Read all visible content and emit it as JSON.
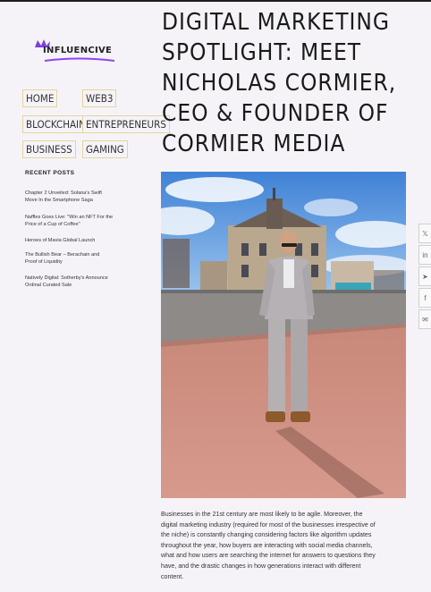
{
  "site": {
    "logo_text": "INFLUENCIVE"
  },
  "nav": {
    "home": "HOME",
    "web3": "WEB3",
    "blockchain": "BLOCKCHAIN",
    "entrepreneurs": "ENTREPRENEURS",
    "business": "BUSINESS",
    "gaming": "GAMING"
  },
  "recent_posts": {
    "title": "RECENT POSTS",
    "items": [
      {
        "l1": "Chapter 2 Unveiled: Solana's Swift",
        "l2": "Move In the Smartphone Saga"
      },
      {
        "l1": "Naffles Goes Live: \"Win an NFT For the",
        "l2": "Price of a Cup of Coffee\""
      },
      {
        "l1": "Heroes of Mavia Global Launch",
        "l2": ""
      },
      {
        "l1": "The Bullish Bear – Berachain and",
        "l2": "Proof of Liquidity"
      },
      {
        "l1": "Natively Digital: Sotherby's Announce",
        "l2": "Ordinal Curated Sale"
      }
    ]
  },
  "article": {
    "headline_lines": [
      "DIGITAL MARKETING",
      "SPOTLIGHT: MEET",
      "NICHOLAS CORMIER,",
      "CEO & FOUNDER OF",
      "CORMIER MEDIA"
    ],
    "body_lines": [
      "Businesses in the 21st century are most likely to be agile. Moreover, the",
      "digital marketing industry (required for most of the businesses irrespective of",
      "the niche) is constantly changing considering factors like algorithm updates",
      "throughout the year, how buyers are interacting with social media channels,",
      "what and how users are searching the internet for answers to questions they",
      "have, and the drastic changes in how generations interact with different",
      "content."
    ]
  },
  "share": {
    "twitter": "𝕏",
    "linkedin": "in",
    "telegram": "➤",
    "facebook": "f",
    "email": "✉"
  }
}
